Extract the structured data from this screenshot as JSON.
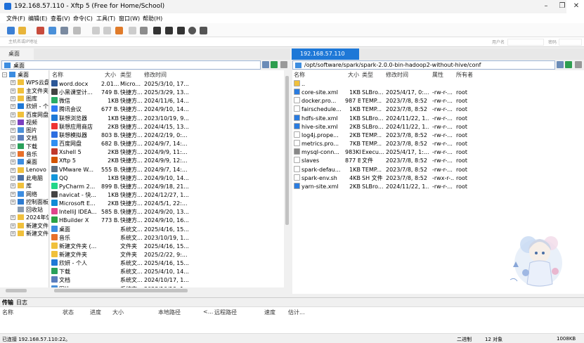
{
  "window": {
    "title": "192.168.57.110   - Xftp 5 (Free for Home/School)"
  },
  "menu": [
    "文件(F)",
    "编辑(E)",
    "查看(V)",
    "命令(C)",
    "工具(T)",
    "窗口(W)",
    "帮助(H)"
  ],
  "address_bar": {
    "placeholder": "主机名或IP地址",
    "user_label": "用户名",
    "password_label": "密码"
  },
  "local": {
    "tab": "桌面",
    "path": "桌面",
    "tree": [
      {
        "label": "桌面",
        "icon": "folder-blue"
      },
      {
        "label": "WPS云盘",
        "icon": "folder"
      },
      {
        "label": "主文件夹",
        "icon": "folder"
      },
      {
        "label": "图库",
        "icon": "folder"
      },
      {
        "label": "欣妍 - 个人",
        "icon": "cloud"
      },
      {
        "label": "百度网盘",
        "icon": "folder"
      },
      {
        "label": "视频",
        "icon": "video"
      },
      {
        "label": "图片",
        "icon": "picture"
      },
      {
        "label": "文档",
        "icon": "doc"
      },
      {
        "label": "下载",
        "icon": "download"
      },
      {
        "label": "音乐",
        "icon": "music"
      },
      {
        "label": "桌面",
        "icon": "folder-blue"
      },
      {
        "label": "Lenovo",
        "icon": "folder"
      },
      {
        "label": "此电脑",
        "icon": "pc"
      },
      {
        "label": "库",
        "icon": "folder"
      },
      {
        "label": "网络",
        "icon": "network"
      },
      {
        "label": "控制面板",
        "icon": "control"
      },
      {
        "label": "回收站",
        "icon": "recycle"
      },
      {
        "label": "2024年信",
        "icon": "folder"
      },
      {
        "label": "新建文件夹",
        "icon": "folder"
      },
      {
        "label": "新建文件",
        "icon": "folder"
      }
    ],
    "columns": [
      "名称",
      "大小",
      "类型",
      "修改时间"
    ],
    "files": [
      {
        "name": "word.docx",
        "size": "2.01...",
        "type": "Micro...",
        "modified": "2025/3/10, 17...",
        "color": "#2b5797"
      },
      {
        "name": "小黑课堂计...",
        "size": "749 B...",
        "type": "快捷方...",
        "modified": "2025/3/29, 13...",
        "color": "#444"
      },
      {
        "name": "微信",
        "size": "1KB",
        "type": "快捷方...",
        "modified": "2024/11/6, 14...",
        "color": "#2aae67"
      },
      {
        "name": "腾讯会议",
        "size": "677 B...",
        "type": "快捷方...",
        "modified": "2024/9/10, 14...",
        "color": "#2f7cf6"
      },
      {
        "name": "联想浏览器",
        "size": "1KB",
        "type": "快捷方...",
        "modified": "2023/10/19, 9...",
        "color": "#1e78d7"
      },
      {
        "name": "联想应用商店",
        "size": "2KB",
        "type": "快捷方...",
        "modified": "2024/4/15, 13...",
        "color": "#e33"
      },
      {
        "name": "联想模拟器",
        "size": "803 B...",
        "type": "快捷方...",
        "modified": "2024/2/19, 0:...",
        "color": "#2d6ee0"
      },
      {
        "name": "百度网盘",
        "size": "682 B...",
        "type": "快捷方...",
        "modified": "2024/9/7, 14:...",
        "color": "#2f8ef2"
      },
      {
        "name": "Xshell 5",
        "size": "2KB",
        "type": "快捷方...",
        "modified": "2024/9/9, 11:...",
        "color": "#c0392b"
      },
      {
        "name": "Xftp 5",
        "size": "2KB",
        "type": "快捷方...",
        "modified": "2024/9/9, 12:...",
        "color": "#d35400"
      },
      {
        "name": "VMware W...",
        "size": "555 B...",
        "type": "快捷方...",
        "modified": "2024/9/7, 14:...",
        "color": "#607080"
      },
      {
        "name": "QQ",
        "size": "1KB",
        "type": "快捷方...",
        "modified": "2024/9/10, 14...",
        "color": "#1296db"
      },
      {
        "name": "PyCharm 2...",
        "size": "899 B...",
        "type": "快捷方...",
        "modified": "2024/9/18, 21...",
        "color": "#21d789"
      },
      {
        "name": "navicat - 快...",
        "size": "1KB",
        "type": "快捷方...",
        "modified": "2024/12/27, 1...",
        "color": "#444"
      },
      {
        "name": "Microsoft E...",
        "size": "2KB",
        "type": "快捷方...",
        "modified": "2024/5/1, 22:...",
        "color": "#0f8bd6"
      },
      {
        "name": "IntelliJ IDEA...",
        "size": "585 B...",
        "type": "快捷方...",
        "modified": "2024/9/20, 13...",
        "color": "#e0448b"
      },
      {
        "name": "HBuilder X",
        "size": "773 B...",
        "type": "快捷方...",
        "modified": "2024/9/10, 16...",
        "color": "#2ba245"
      },
      {
        "name": "桌面",
        "size": "",
        "type": "系统文...",
        "modified": "2025/4/16, 15...",
        "color": "#3d8de0"
      },
      {
        "name": "音乐",
        "size": "",
        "type": "系统文...",
        "modified": "2023/10/19, 1...",
        "color": "#e8702a"
      },
      {
        "name": "新建文件夹 (...",
        "size": "",
        "type": "文件夹",
        "modified": "2025/4/16, 15...",
        "color": "#f0c03c"
      },
      {
        "name": "新建文件夹",
        "size": "",
        "type": "文件夹",
        "modified": "2025/2/22, 9:...",
        "color": "#f0c03c"
      },
      {
        "name": "欣妍 - 个人",
        "size": "",
        "type": "系统文...",
        "modified": "2025/4/16, 15...",
        "color": "#1e78d7"
      },
      {
        "name": "下载",
        "size": "",
        "type": "系统文...",
        "modified": "2025/4/10, 14...",
        "color": "#2aa05a"
      },
      {
        "name": "文档",
        "size": "",
        "type": "系统文...",
        "modified": "2024/10/17, 1...",
        "color": "#5a7dbc"
      },
      {
        "name": "图片",
        "size": "",
        "type": "系统文...",
        "modified": "2023/10/19, 1...",
        "color": "#4a90d9"
      }
    ]
  },
  "remote": {
    "tab": "192.168.57.110",
    "path": "/opt/software/spark/spark-2.0.0-bin-hadoop2-without-hive/conf",
    "columns": [
      "名称",
      "大小",
      "类型",
      "修改时间",
      "属性",
      "所有者"
    ],
    "files": [
      {
        "name": "..",
        "size": "",
        "type": "",
        "modified": "",
        "attr": "",
        "owner": "",
        "color": "#f0c03c"
      },
      {
        "name": "core-site.xml",
        "size": "1KB",
        "type": "SLBro...",
        "modified": "2025/4/17, 0:...",
        "attr": "-rw-r-...",
        "owner": "root",
        "color": "#2a7ce0"
      },
      {
        "name": "docker.pro...",
        "size": "987 B...",
        "type": "TEMP...",
        "modified": "2023/7/8, 8:52",
        "attr": "-rw-r-...",
        "owner": "root",
        "color": "#fff"
      },
      {
        "name": "fairschedule...",
        "size": "1KB",
        "type": "TEMP...",
        "modified": "2023/7/8, 8:52",
        "attr": "-rw-r-...",
        "owner": "root",
        "color": "#fff"
      },
      {
        "name": "hdfs-site.xml",
        "size": "1KB",
        "type": "SLBro...",
        "modified": "2024/11/22, 1...",
        "attr": "-rw-r-...",
        "owner": "root",
        "color": "#2a7ce0"
      },
      {
        "name": "hive-site.xml",
        "size": "2KB",
        "type": "SLBro...",
        "modified": "2024/11/22, 1...",
        "attr": "-rw-r-...",
        "owner": "root",
        "color": "#2a7ce0"
      },
      {
        "name": "log4j.prope...",
        "size": "2KB",
        "type": "TEMP...",
        "modified": "2023/7/8, 8:52",
        "attr": "-rw-r-...",
        "owner": "root",
        "color": "#fff"
      },
      {
        "name": "metrics.pro...",
        "size": "7KB",
        "type": "TEMP...",
        "modified": "2023/7/8, 8:52",
        "attr": "-rw-r-...",
        "owner": "root",
        "color": "#fff"
      },
      {
        "name": "mysql-conn...",
        "size": "983KB",
        "type": "Execu...",
        "modified": "2025/4/17, 1:...",
        "attr": "-rw-r-...",
        "owner": "root",
        "color": "#888"
      },
      {
        "name": "slaves",
        "size": "877 B...",
        "type": "文件",
        "modified": "2023/7/8, 8:52",
        "attr": "-rw-r-...",
        "owner": "root",
        "color": "#fff"
      },
      {
        "name": "spark-defau...",
        "size": "1KB",
        "type": "TEMP...",
        "modified": "2023/7/8, 8:52",
        "attr": "-rw-r-...",
        "owner": "root",
        "color": "#fff"
      },
      {
        "name": "spark-env.sh",
        "size": "4KB",
        "type": "SH 文件",
        "modified": "2023/7/8, 8:52",
        "attr": "-rwx-r-...",
        "owner": "root",
        "color": "#fff"
      },
      {
        "name": "yarn-site.xml",
        "size": "2KB",
        "type": "SLBro...",
        "modified": "2024/11/22, 1...",
        "attr": "-rw-r-...",
        "owner": "root",
        "color": "#2a7ce0"
      }
    ]
  },
  "bottom_tabs": [
    "传输",
    "日志"
  ],
  "transfer_columns": [
    "名称",
    "状态",
    "进度",
    "大小",
    "本地路径",
    "<...",
    "远程路径",
    "速度",
    "估计..."
  ],
  "status": {
    "left": "已连接 192.168.57.110:22。",
    "mode": "二进制",
    "count": "12 对象",
    "size": "1008KB"
  }
}
